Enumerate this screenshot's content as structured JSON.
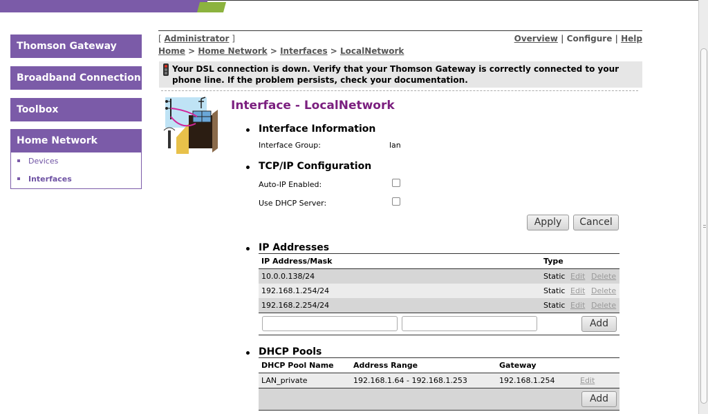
{
  "sidebar": {
    "items": [
      {
        "label": "Thomson Gateway"
      },
      {
        "label": "Broadband Connection"
      },
      {
        "label": "Toolbox"
      },
      {
        "label": "Home Network"
      }
    ],
    "subitems": [
      {
        "label": "Devices"
      },
      {
        "label": "Interfaces"
      }
    ]
  },
  "header": {
    "bracket_open": "[",
    "bracket_close": "]",
    "user": "Administrator",
    "links": {
      "overview": "Overview",
      "sep": "|",
      "configure": "Configure",
      "help": "Help"
    },
    "breadcrumb": [
      "Home",
      "Home Network",
      "Interfaces",
      "LocalNetwork"
    ],
    "breadcrumb_sep": ">"
  },
  "alert": {
    "line1": "Your DSL connection is down. Verify that your Thomson Gateway is correctly connected to your",
    "line2": "phone line. If the problem persists, check your documentation."
  },
  "page": {
    "title": "Interface - LocalNetwork"
  },
  "interface_info": {
    "heading": "Interface Information",
    "group_label": "Interface Group:",
    "group_value": "lan"
  },
  "tcpip": {
    "heading": "TCP/IP Configuration",
    "autoip_label": "Auto-IP Enabled:",
    "dhcp_label": "Use DHCP Server:",
    "apply": "Apply",
    "cancel": "Cancel"
  },
  "ip_addresses": {
    "heading": "IP Addresses",
    "col_addr": "IP Address/Mask",
    "col_type": "Type",
    "rows": [
      {
        "addr": "10.0.0.138/24",
        "type": "Static",
        "edit": "Edit",
        "delete": "Delete"
      },
      {
        "addr": "192.168.1.254/24",
        "type": "Static",
        "edit": "Edit",
        "delete": "Delete"
      },
      {
        "addr": "192.168.2.254/24",
        "type": "Static",
        "edit": "Edit",
        "delete": "Delete"
      }
    ],
    "add": "Add"
  },
  "dhcp_pools": {
    "heading": "DHCP Pools",
    "col_name": "DHCP Pool Name",
    "col_range": "Address Range",
    "col_gateway": "Gateway",
    "rows": [
      {
        "name": "LAN_private",
        "range": "192.168.1.64 - 192.168.1.253",
        "gateway": "192.168.1.254",
        "edit": "Edit"
      }
    ],
    "add": "Add"
  },
  "colors": {
    "brand_purple": "#7b5ba8",
    "brand_green": "#8cb33e",
    "title_purple": "#7b1f7f"
  }
}
